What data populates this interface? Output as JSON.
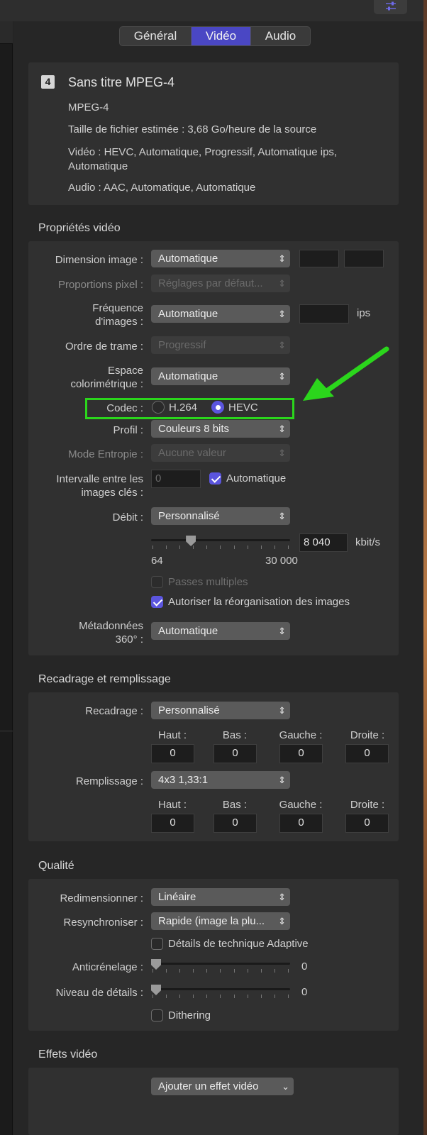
{
  "tabs": {
    "general": "Général",
    "video": "Vidéo",
    "audio": "Audio",
    "active": "Vidéo"
  },
  "summary": {
    "badge": "4",
    "title": "Sans titre MPEG-4",
    "format": "MPEG-4",
    "filesize": "Taille de fichier estimée : 3,68 Go/heure de la source",
    "video_line1": "Vidéo : HEVC, Automatique, Progressif, Automatique ips,",
    "video_line2": "Automatique",
    "audio": "Audio : AAC, Automatique, Automatique"
  },
  "video_props": {
    "title": "Propriétés vidéo",
    "dimension_label": "Dimension image :",
    "dimension_value": "Automatique",
    "pixel_label": "Proportions pixel :",
    "pixel_value": "Réglages par défaut...",
    "framerate_label_1": "Fréquence",
    "framerate_label_2": "d'images :",
    "framerate_value": "Automatique",
    "framerate_unit": "ips",
    "field_order_label": "Ordre de trame :",
    "field_order_value": "Progressif",
    "colorspace_label_1": "Espace",
    "colorspace_label_2": "colorimétrique :",
    "colorspace_value": "Automatique",
    "codec_label": "Codec :",
    "codec_option_1": "H.264",
    "codec_option_2": "HEVC",
    "codec_selected": "HEVC",
    "profile_label": "Profil :",
    "profile_value": "Couleurs 8 bits",
    "entropy_label": "Mode Entropie :",
    "entropy_value": "Aucune valeur",
    "keyframe_label_1": "Intervalle entre les",
    "keyframe_label_2": "images clés :",
    "keyframe_value": "0",
    "keyframe_auto_label": "Automatique",
    "bitrate_label": "Débit :",
    "bitrate_value": "Personnalisé",
    "bitrate_field": "8 040",
    "bitrate_unit": "kbit/s",
    "bitrate_min": "64",
    "bitrate_max": "30 000",
    "bitrate_slider_fraction": 0.27,
    "multipass_label": "Passes multiples",
    "reorder_label": "Autoriser la réorganisation des images",
    "meta360_label_1": "Métadonnées",
    "meta360_label_2": "360° :",
    "meta360_value": "Automatique"
  },
  "crop": {
    "title": "Recadrage et remplissage",
    "crop_label": "Recadrage :",
    "crop_value": "Personnalisé",
    "pad_label": "Remplissage :",
    "pad_value": "4x3 1,33:1",
    "col_top": "Haut :",
    "col_bottom": "Bas :",
    "col_left": "Gauche :",
    "col_right": "Droite :",
    "crop_top": "0",
    "crop_bottom": "0",
    "crop_left": "0",
    "crop_right": "0",
    "pad_top": "0",
    "pad_bottom": "0",
    "pad_left": "0",
    "pad_right": "0"
  },
  "quality": {
    "title": "Qualité",
    "resize_label": "Redimensionner :",
    "resize_value": "Linéaire",
    "retime_label": "Resynchroniser :",
    "retime_value": "Rapide (image la plu...",
    "adaptive_label": "Détails de technique Adaptive",
    "antialias_label": "Anticrénelage :",
    "antialias_value": "0",
    "antialias_fraction": 0,
    "detail_label": "Niveau de détails :",
    "detail_value": "0",
    "detail_fraction": 0,
    "dither_label": "Dithering"
  },
  "effects": {
    "title": "Effets vidéo",
    "add_effect": "Ajouter un effet vidéo"
  },
  "colors": {
    "accent": "#5b55de",
    "tab_active": "#4a47c4",
    "highlight": "#2bd61c"
  }
}
